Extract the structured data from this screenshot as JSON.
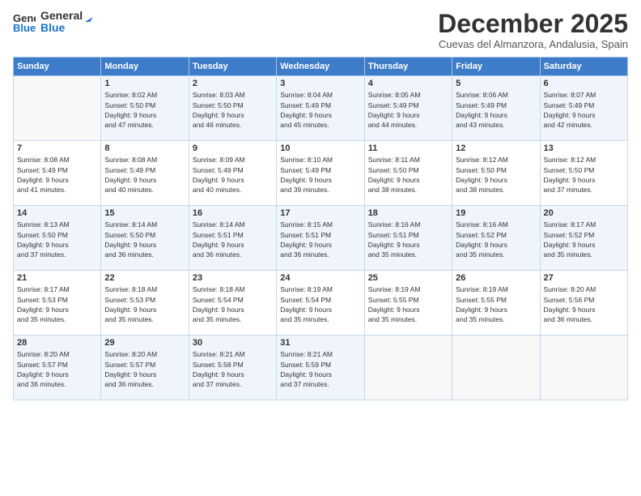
{
  "header": {
    "logo_line1": "General",
    "logo_line2": "Blue",
    "month": "December 2025",
    "location": "Cuevas del Almanzora, Andalusia, Spain"
  },
  "days_of_week": [
    "Sunday",
    "Monday",
    "Tuesday",
    "Wednesday",
    "Thursday",
    "Friday",
    "Saturday"
  ],
  "weeks": [
    [
      {
        "day": "",
        "info": ""
      },
      {
        "day": "1",
        "info": "Sunrise: 8:02 AM\nSunset: 5:50 PM\nDaylight: 9 hours\nand 47 minutes."
      },
      {
        "day": "2",
        "info": "Sunrise: 8:03 AM\nSunset: 5:50 PM\nDaylight: 9 hours\nand 46 minutes."
      },
      {
        "day": "3",
        "info": "Sunrise: 8:04 AM\nSunset: 5:49 PM\nDaylight: 9 hours\nand 45 minutes."
      },
      {
        "day": "4",
        "info": "Sunrise: 8:05 AM\nSunset: 5:49 PM\nDaylight: 9 hours\nand 44 minutes."
      },
      {
        "day": "5",
        "info": "Sunrise: 8:06 AM\nSunset: 5:49 PM\nDaylight: 9 hours\nand 43 minutes."
      },
      {
        "day": "6",
        "info": "Sunrise: 8:07 AM\nSunset: 5:49 PM\nDaylight: 9 hours\nand 42 minutes."
      }
    ],
    [
      {
        "day": "7",
        "info": "Sunrise: 8:08 AM\nSunset: 5:49 PM\nDaylight: 9 hours\nand 41 minutes."
      },
      {
        "day": "8",
        "info": "Sunrise: 8:08 AM\nSunset: 5:49 PM\nDaylight: 9 hours\nand 40 minutes."
      },
      {
        "day": "9",
        "info": "Sunrise: 8:09 AM\nSunset: 5:49 PM\nDaylight: 9 hours\nand 40 minutes."
      },
      {
        "day": "10",
        "info": "Sunrise: 8:10 AM\nSunset: 5:49 PM\nDaylight: 9 hours\nand 39 minutes."
      },
      {
        "day": "11",
        "info": "Sunrise: 8:11 AM\nSunset: 5:50 PM\nDaylight: 9 hours\nand 38 minutes."
      },
      {
        "day": "12",
        "info": "Sunrise: 8:12 AM\nSunset: 5:50 PM\nDaylight: 9 hours\nand 38 minutes."
      },
      {
        "day": "13",
        "info": "Sunrise: 8:12 AM\nSunset: 5:50 PM\nDaylight: 9 hours\nand 37 minutes."
      }
    ],
    [
      {
        "day": "14",
        "info": "Sunrise: 8:13 AM\nSunset: 5:50 PM\nDaylight: 9 hours\nand 37 minutes."
      },
      {
        "day": "15",
        "info": "Sunrise: 8:14 AM\nSunset: 5:50 PM\nDaylight: 9 hours\nand 36 minutes."
      },
      {
        "day": "16",
        "info": "Sunrise: 8:14 AM\nSunset: 5:51 PM\nDaylight: 9 hours\nand 36 minutes."
      },
      {
        "day": "17",
        "info": "Sunrise: 8:15 AM\nSunset: 5:51 PM\nDaylight: 9 hours\nand 36 minutes."
      },
      {
        "day": "18",
        "info": "Sunrise: 8:16 AM\nSunset: 5:51 PM\nDaylight: 9 hours\nand 35 minutes."
      },
      {
        "day": "19",
        "info": "Sunrise: 8:16 AM\nSunset: 5:52 PM\nDaylight: 9 hours\nand 35 minutes."
      },
      {
        "day": "20",
        "info": "Sunrise: 8:17 AM\nSunset: 5:52 PM\nDaylight: 9 hours\nand 35 minutes."
      }
    ],
    [
      {
        "day": "21",
        "info": "Sunrise: 8:17 AM\nSunset: 5:53 PM\nDaylight: 9 hours\nand 35 minutes."
      },
      {
        "day": "22",
        "info": "Sunrise: 8:18 AM\nSunset: 5:53 PM\nDaylight: 9 hours\nand 35 minutes."
      },
      {
        "day": "23",
        "info": "Sunrise: 8:18 AM\nSunset: 5:54 PM\nDaylight: 9 hours\nand 35 minutes."
      },
      {
        "day": "24",
        "info": "Sunrise: 8:19 AM\nSunset: 5:54 PM\nDaylight: 9 hours\nand 35 minutes."
      },
      {
        "day": "25",
        "info": "Sunrise: 8:19 AM\nSunset: 5:55 PM\nDaylight: 9 hours\nand 35 minutes."
      },
      {
        "day": "26",
        "info": "Sunrise: 8:19 AM\nSunset: 5:55 PM\nDaylight: 9 hours\nand 35 minutes."
      },
      {
        "day": "27",
        "info": "Sunrise: 8:20 AM\nSunset: 5:56 PM\nDaylight: 9 hours\nand 36 minutes."
      }
    ],
    [
      {
        "day": "28",
        "info": "Sunrise: 8:20 AM\nSunset: 5:57 PM\nDaylight: 9 hours\nand 36 minutes."
      },
      {
        "day": "29",
        "info": "Sunrise: 8:20 AM\nSunset: 5:57 PM\nDaylight: 9 hours\nand 36 minutes."
      },
      {
        "day": "30",
        "info": "Sunrise: 8:21 AM\nSunset: 5:58 PM\nDaylight: 9 hours\nand 37 minutes."
      },
      {
        "day": "31",
        "info": "Sunrise: 8:21 AM\nSunset: 5:59 PM\nDaylight: 9 hours\nand 37 minutes."
      },
      {
        "day": "",
        "info": ""
      },
      {
        "day": "",
        "info": ""
      },
      {
        "day": "",
        "info": ""
      }
    ]
  ]
}
